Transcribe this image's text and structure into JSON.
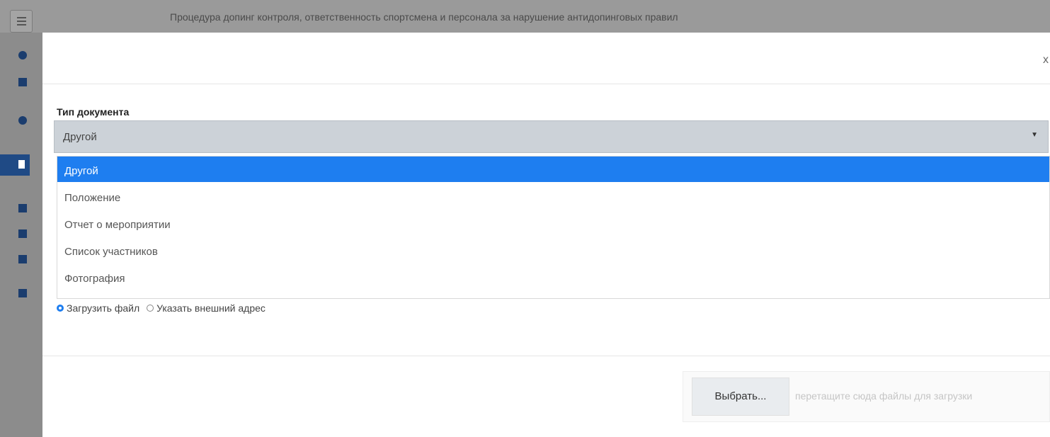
{
  "app": {
    "title": "Процедура допинг контроля, ответственность спортсмена и персонала за нарушение антидопинговых правил"
  },
  "sidebar": {
    "icons": [
      "info-icon",
      "users-icon",
      "info-icon",
      "document-icon",
      "key-icon",
      "video-icon",
      "print-icon",
      "play-icon"
    ]
  },
  "modal": {
    "close_label": "x",
    "document_type": {
      "label": "Тип документа",
      "selected": "Другой",
      "options": [
        "Другой",
        "Положение",
        "Отчет о мероприятии",
        "Список участников",
        "Фотография"
      ]
    },
    "source": {
      "upload_label": "Загрузить файл",
      "external_label": "Указать внешний адрес",
      "selected": "upload"
    },
    "upload": {
      "button_label": "Выбрать...",
      "drop_hint": "перетащите сюда файлы для загрузки"
    }
  },
  "colors": {
    "accent": "#1e7ef0",
    "overlay": "#8f8f8f",
    "select_bg": "#ccd2d8"
  }
}
